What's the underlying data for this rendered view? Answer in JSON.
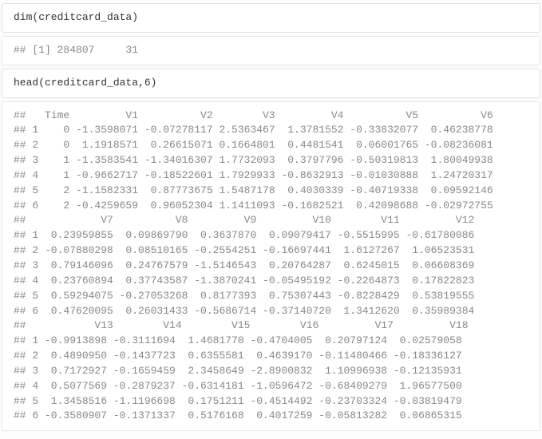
{
  "cells": {
    "code1": "dim(creditcard_data)",
    "out1": "## [1] 284807     31",
    "code2": "head(creditcard_data,6)",
    "out2_lines": [
      "##   Time         V1          V2        V3         V4          V5          V6",
      "## 1    0 -1.3598071 -0.07278117 2.5363467  1.3781552 -0.33832077  0.46238778",
      "## 2    0  1.1918571  0.26615071 0.1664801  0.4481541  0.06001765 -0.08236081",
      "## 3    1 -1.3583541 -1.34016307 1.7732093  0.3797796 -0.50319813  1.80049938",
      "## 4    1 -0.9662717 -0.18522601 1.7929933 -0.8632913 -0.01030888  1.24720317",
      "## 5    2 -1.1582331  0.87773675 1.5487178  0.4030339 -0.40719338  0.09592146",
      "## 6    2 -0.4259659  0.96052304 1.1411093 -0.1682521  0.42098688 -0.02972755",
      "##            V7          V8         V9         V10        V11         V12",
      "## 1  0.23959855  0.09869790  0.3637870  0.09079417 -0.5515995 -0.61780086",
      "## 2 -0.07880298  0.08510165 -0.2554251 -0.16697441  1.6127267  1.06523531",
      "## 3  0.79146096  0.24767579 -1.5146543  0.20764287  0.6245015  0.06608369",
      "## 4  0.23760894  0.37743587 -1.3870241 -0.05495192 -0.2264873  0.17822823",
      "## 5  0.59294075 -0.27053268  0.8177393  0.75307443 -0.8228429  0.53819555",
      "## 6  0.47620095  0.26031433 -0.5686714 -0.37140720  1.3412620  0.35989384",
      "##           V13        V14        V15        V16         V17         V18",
      "## 1 -0.9913898 -0.3111694  1.4681770 -0.4704005  0.20797124  0.02579058",
      "## 2  0.4890950 -0.1437723  0.6355581  0.4639170 -0.11480466 -0.18336127",
      "## 3  0.7172927 -0.1659459  2.3458649 -2.8900832  1.10996938 -0.12135931",
      "## 4  0.5077569 -0.2879237 -0.6314181 -1.0596472 -0.68409279  1.96577500",
      "## 5  1.3458516 -1.1196698  0.1751211 -0.4514492 -0.23703324 -0.03819479",
      "## 6 -0.3580907 -0.1371337  0.5176168  0.4017259 -0.05813282  0.06865315"
    ]
  },
  "chart_data": {
    "type": "table",
    "title": "head(creditcard_data,6)",
    "dim": {
      "rows": 284807,
      "cols": 31
    },
    "columns": [
      "Time",
      "V1",
      "V2",
      "V3",
      "V4",
      "V5",
      "V6",
      "V7",
      "V8",
      "V9",
      "V10",
      "V11",
      "V12",
      "V13",
      "V14",
      "V15",
      "V16",
      "V17",
      "V18"
    ],
    "rows": [
      {
        "Time": 0,
        "V1": -1.3598071,
        "V2": -0.07278117,
        "V3": 2.5363467,
        "V4": 1.3781552,
        "V5": -0.33832077,
        "V6": 0.46238778,
        "V7": 0.23959855,
        "V8": 0.0986979,
        "V9": 0.363787,
        "V10": 0.09079417,
        "V11": -0.5515995,
        "V12": -0.61780086,
        "V13": -0.9913898,
        "V14": -0.3111694,
        "V15": 1.468177,
        "V16": -0.4704005,
        "V17": 0.20797124,
        "V18": 0.02579058
      },
      {
        "Time": 0,
        "V1": 1.1918571,
        "V2": 0.26615071,
        "V3": 0.1664801,
        "V4": 0.4481541,
        "V5": 0.06001765,
        "V6": -0.08236081,
        "V7": -0.07880298,
        "V8": 0.08510165,
        "V9": -0.2554251,
        "V10": -0.16697441,
        "V11": 1.6127267,
        "V12": 1.06523531,
        "V13": 0.489095,
        "V14": -0.1437723,
        "V15": 0.6355581,
        "V16": 0.463917,
        "V17": -0.11480466,
        "V18": -0.18336127
      },
      {
        "Time": 1,
        "V1": -1.3583541,
        "V2": -1.34016307,
        "V3": 1.7732093,
        "V4": 0.3797796,
        "V5": -0.50319813,
        "V6": 1.80049938,
        "V7": 0.79146096,
        "V8": 0.24767579,
        "V9": -1.5146543,
        "V10": 0.20764287,
        "V11": 0.6245015,
        "V12": 0.06608369,
        "V13": 0.7172927,
        "V14": -0.1659459,
        "V15": 2.3458649,
        "V16": -2.8900832,
        "V17": 1.10996938,
        "V18": -0.12135931
      },
      {
        "Time": 1,
        "V1": -0.9662717,
        "V2": -0.18522601,
        "V3": 1.7929933,
        "V4": -0.8632913,
        "V5": -0.01030888,
        "V6": 1.24720317,
        "V7": 0.23760894,
        "V8": 0.37743587,
        "V9": -1.3870241,
        "V10": -0.05495192,
        "V11": -0.2264873,
        "V12": 0.17822823,
        "V13": 0.5077569,
        "V14": -0.2879237,
        "V15": -0.6314181,
        "V16": -1.0596472,
        "V17": -0.68409279,
        "V18": 1.965775
      },
      {
        "Time": 2,
        "V1": -1.1582331,
        "V2": 0.87773675,
        "V3": 1.5487178,
        "V4": 0.4030339,
        "V5": -0.40719338,
        "V6": 0.09592146,
        "V7": 0.59294075,
        "V8": -0.27053268,
        "V9": 0.8177393,
        "V10": 0.75307443,
        "V11": -0.8228429,
        "V12": 0.53819555,
        "V13": 1.3458516,
        "V14": -1.1196698,
        "V15": 0.1751211,
        "V16": -0.4514492,
        "V17": -0.23703324,
        "V18": -0.03819479
      },
      {
        "Time": 2,
        "V1": -0.4259659,
        "V2": 0.96052304,
        "V3": 1.1411093,
        "V4": -0.1682521,
        "V5": 0.42098688,
        "V6": -0.02972755,
        "V7": 0.47620095,
        "V8": 0.26031433,
        "V9": -0.5686714,
        "V10": -0.3714072,
        "V11": 1.341262,
        "V12": 0.35989384,
        "V13": -0.3580907,
        "V14": -0.1371337,
        "V15": 0.5176168,
        "V16": 0.4017259,
        "V17": -0.05813282,
        "V18": 0.06865315
      }
    ]
  }
}
